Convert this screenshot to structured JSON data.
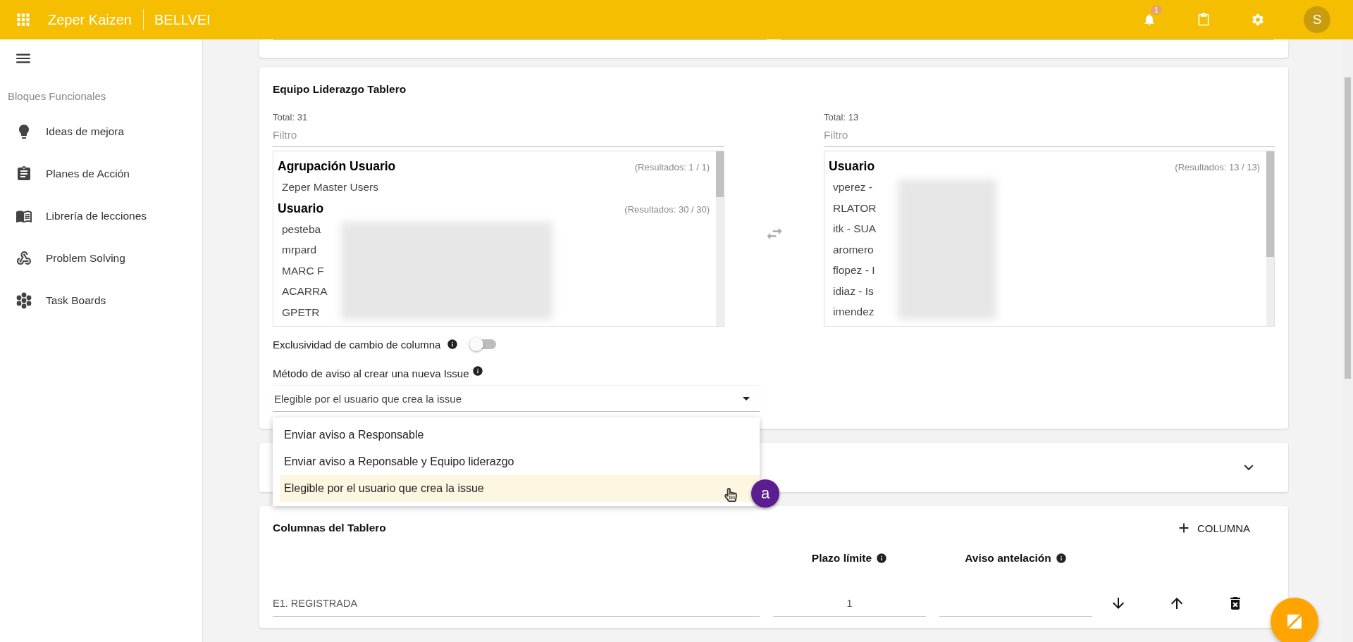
{
  "app_bar": {
    "app_name": "Zeper Kaizen",
    "workspace": "BELLVEI",
    "notification_badge": "1",
    "avatar": "S"
  },
  "sidebar": {
    "section": "Bloques Funcionales",
    "items": [
      {
        "label": "Ideas de mejora"
      },
      {
        "label": "Planes de Acción"
      },
      {
        "label": "Librería de lecciones"
      },
      {
        "label": "Problem Solving"
      },
      {
        "label": "Task Boards"
      }
    ]
  },
  "leadership_team": {
    "title": "Equipo Liderazgo Tablero",
    "available": {
      "total": "Total: 31",
      "filter_placeholder": "Filtro",
      "groups": [
        {
          "heading": "Agrupación Usuario",
          "results": "(Resultados: 1 / 1)",
          "redacted": false,
          "items": [
            "Zeper Master Users"
          ]
        },
        {
          "heading": "Usuario",
          "results": "(Resultados: 30 / 30)",
          "redacted": true,
          "items": [
            "pesteba",
            "mrpard",
            "MARC F",
            "ACARRA",
            "GPETR"
          ]
        }
      ]
    },
    "chosen": {
      "total": "Total: 13",
      "filter_placeholder": "Filtro",
      "groups": [
        {
          "heading": "Usuario",
          "results": "(Resultados: 13 / 13)",
          "redacted": true,
          "items": [
            "vperez -",
            "RLATOR",
            "itk - SUA",
            "aromero",
            "flopez - I",
            "idiaz - Is",
            "imendez"
          ]
        }
      ]
    }
  },
  "exclusivity": {
    "label": "Exclusividad de cambio de columna",
    "on": false
  },
  "notify_method": {
    "label": "Método de aviso al crear una nueva Issue",
    "value": "Elegible por el usuario que crea la issue",
    "options": [
      {
        "label": "Enviar aviso a Responsable",
        "selected": false
      },
      {
        "label": "Enviar aviso a Reponsable y Equipo liderazgo",
        "selected": false
      },
      {
        "label": "Elegible por el usuario que crea la issue",
        "selected": true
      }
    ]
  },
  "marker": "a",
  "columns": {
    "title": "Columnas del Tablero",
    "add_button": "COLUMNA",
    "headers": [
      "Plazo límite",
      "Aviso antelación"
    ],
    "rows": [
      {
        "name": "E1. REGISTRADA",
        "deadline": "1"
      }
    ]
  }
}
